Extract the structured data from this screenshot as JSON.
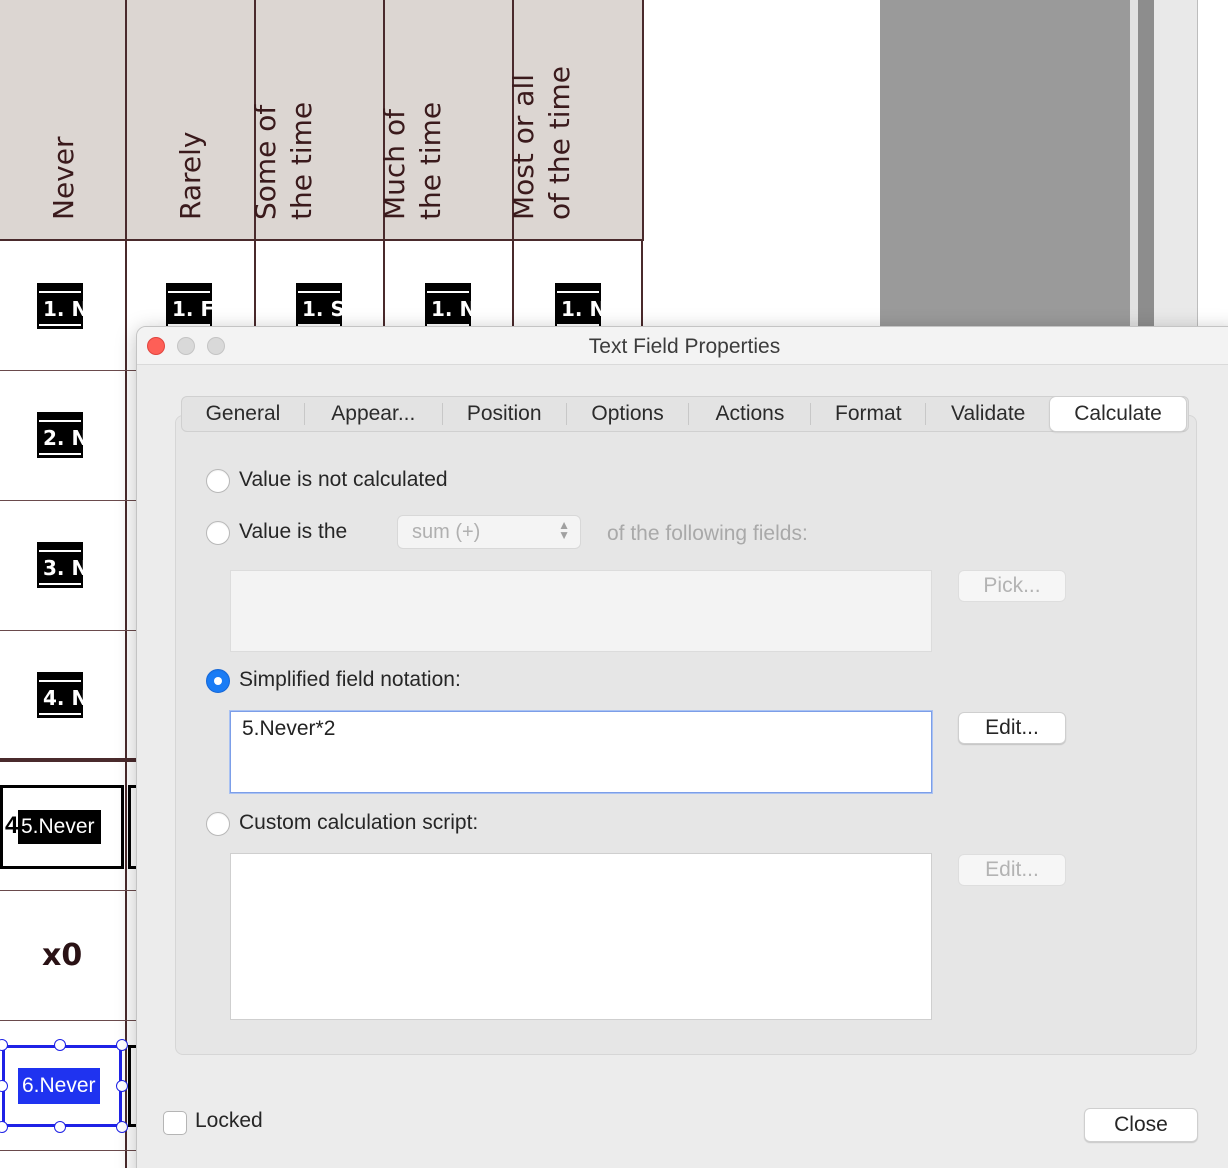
{
  "document": {
    "column_headers": [
      "Never",
      "Rarely",
      "Some of\nthe time",
      "Much of\nthe time",
      "Most or all\nof the time"
    ],
    "row1_fields": [
      "1. N",
      "1. F",
      "1. S",
      "1. N",
      "1. N"
    ],
    "row_fields": [
      "2. N",
      "3. N",
      "4. N"
    ],
    "score_prefix": "4",
    "score_field": "5.Never",
    "multiplier": "x0",
    "selected_field": "6.Never"
  },
  "dialog": {
    "title": "Text Field Properties",
    "tabs": [
      "General",
      "Appear...",
      "Position",
      "Options",
      "Actions",
      "Format",
      "Validate",
      "Calculate"
    ],
    "active_tab": "Calculate",
    "calc": {
      "opt_not_calculated": "Value is not calculated",
      "opt_value_is": "Value is the",
      "operation_select": "sum (+)",
      "following_fields": "of the following fields:",
      "pick_button": "Pick...",
      "opt_simplified": "Simplified field notation:",
      "simplified_value": "5.Never*2",
      "edit_button": "Edit...",
      "opt_custom": "Custom calculation script:",
      "edit_script_button": "Edit...",
      "selected_option": "simplified"
    },
    "locked_label": "Locked",
    "close_button": "Close"
  },
  "colors": {
    "accent": "#1a7cf5",
    "header_fill": "#dcd6d2",
    "grid_line": "#4a2a2c",
    "selection": "#1f22e6"
  }
}
